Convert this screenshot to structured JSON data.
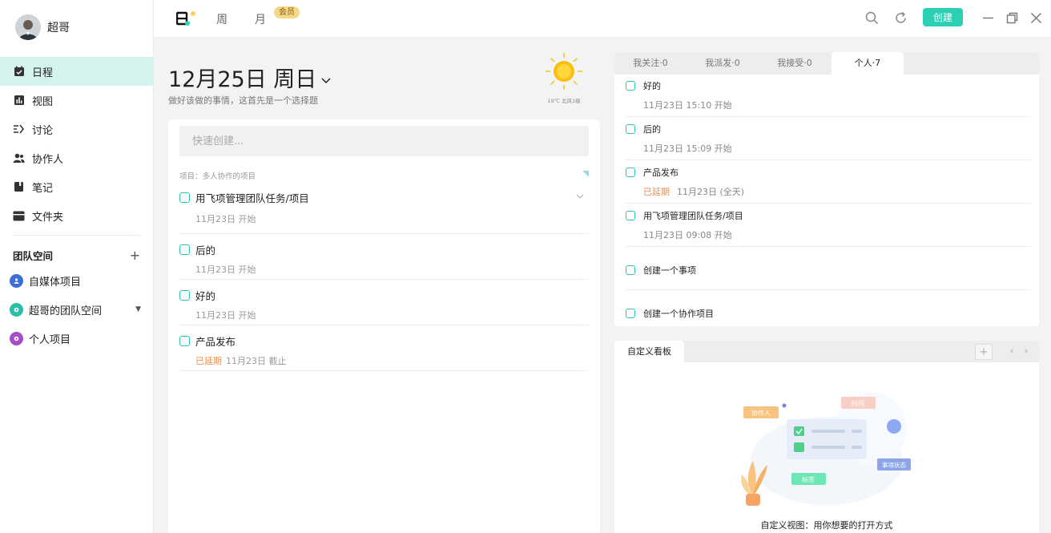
{
  "user": {
    "name": "超哥"
  },
  "nav": [
    {
      "label": "日程",
      "icon": "calendar-icon",
      "active": true
    },
    {
      "label": "视图",
      "icon": "chart-icon"
    },
    {
      "label": "讨论",
      "icon": "discussion-icon"
    },
    {
      "label": "协作人",
      "icon": "people-icon"
    },
    {
      "label": "笔记",
      "icon": "notebook-icon"
    },
    {
      "label": "文件夹",
      "icon": "folder-icon"
    }
  ],
  "team": {
    "title": "团队空间",
    "items": [
      {
        "label": "自媒体项目",
        "color": "#3a6fd8"
      },
      {
        "label": "超哥的团队空间",
        "color": "#2bbfa7"
      },
      {
        "label": "个人项目",
        "color": "#a64fc4"
      }
    ]
  },
  "topbar": {
    "tabs": [
      "周",
      "月"
    ],
    "vip_badge": "会员",
    "create_label": "创建"
  },
  "date": {
    "title": "12月25日 周日",
    "subtitle": "做好该做的事情，这首先是一个选择题"
  },
  "weather": {
    "text": "19℃ 北风1级"
  },
  "quick": {
    "placeholder": "快速创建..."
  },
  "project_label": "项目：多人协作的项目",
  "tasks": [
    {
      "title": "用飞项管理团队任务/项目",
      "meta": "11月23日 开始",
      "overdue": ""
    },
    {
      "title": "后的",
      "meta": "11月23日 开始",
      "overdue": ""
    },
    {
      "title": "好的",
      "meta": "11月23日 开始",
      "overdue": ""
    },
    {
      "title": "产品发布",
      "meta": "11月23日 截止",
      "overdue": "已延期"
    }
  ],
  "right_tabs": [
    "我关注·0",
    "我派发·0",
    "我接受·0",
    "个人·7"
  ],
  "right_tasks": [
    {
      "title": "好的",
      "meta": "11月23日 15:10 开始",
      "overdue": ""
    },
    {
      "title": "后的",
      "meta": "11月23日 15:09 开始",
      "overdue": ""
    },
    {
      "title": "产品发布",
      "meta": "11月23日 (全天)",
      "overdue": "已延期"
    },
    {
      "title": "用飞项管理团队任务/项目",
      "meta": "11月23日 09:08 开始",
      "overdue": ""
    },
    {
      "title": "创建一个事项",
      "meta": "",
      "overdue": ""
    },
    {
      "title": "创建一个协作项目",
      "meta": "",
      "overdue": ""
    }
  ],
  "board": {
    "tab": "自定义看板",
    "caption": "自定义视图：用你想要的打开方式",
    "labels": {
      "collaborator": "协作人",
      "time": "时间",
      "status": "事项状态",
      "tag": "标签"
    }
  },
  "colors": {
    "accent": "#2bd0b4",
    "active_nav": "#d4f3ef",
    "overdue": "#f08c4b"
  }
}
